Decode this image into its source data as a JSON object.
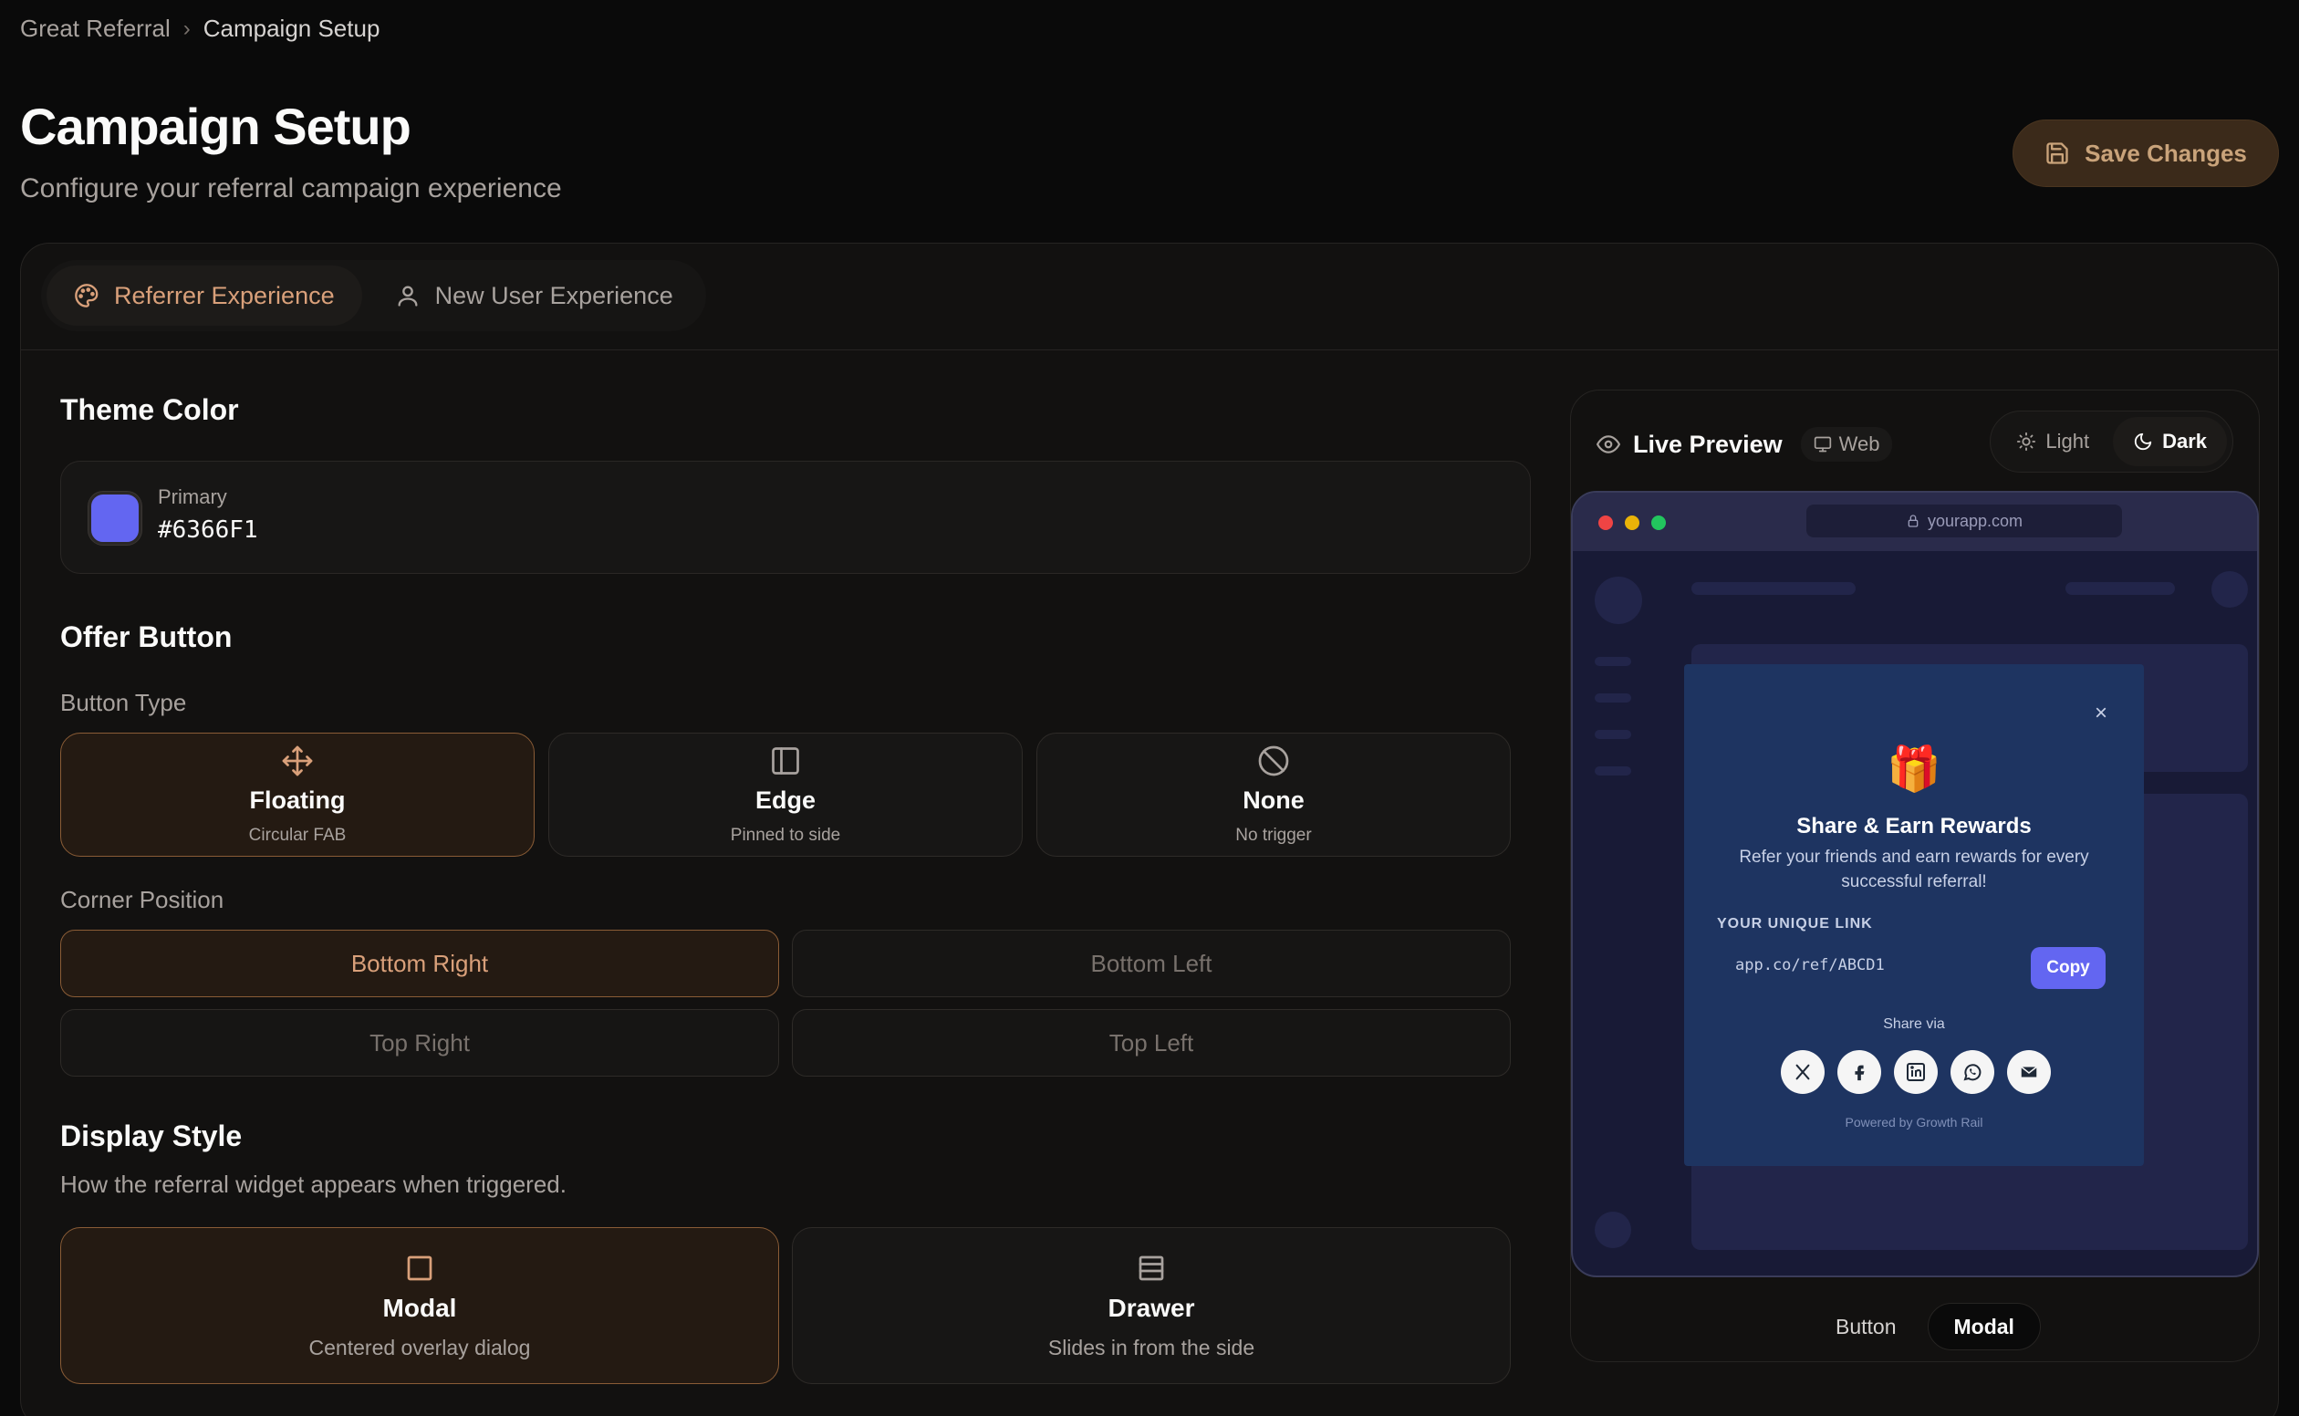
{
  "breadcrumb": {
    "root": "Great Referral",
    "separator": "›",
    "current": "Campaign Setup"
  },
  "header": {
    "title": "Campaign Setup",
    "subtitle": "Configure your referral campaign experience",
    "save_label": "Save Changes"
  },
  "tabs": [
    {
      "label": "Referrer Experience",
      "icon": "palette-icon",
      "active": true
    },
    {
      "label": "New User Experience",
      "icon": "user-icon",
      "active": false
    }
  ],
  "theme": {
    "title": "Theme Color",
    "color_label": "Primary",
    "color_value": "#6366F1"
  },
  "offer_button": {
    "title": "Offer Button",
    "button_type_label": "Button Type",
    "types": [
      {
        "title": "Floating",
        "sub": "Circular FAB",
        "icon": "move-icon",
        "selected": true
      },
      {
        "title": "Edge",
        "sub": "Pinned to side",
        "icon": "panel-left-icon",
        "selected": false
      },
      {
        "title": "None",
        "sub": "No trigger",
        "icon": "ban-icon",
        "selected": false
      }
    ],
    "corner_label": "Corner Position",
    "corners": [
      {
        "label": "Bottom Right",
        "selected": true
      },
      {
        "label": "Bottom Left",
        "selected": false
      },
      {
        "label": "Top Right",
        "selected": false
      },
      {
        "label": "Top Left",
        "selected": false
      }
    ]
  },
  "display_style": {
    "title": "Display Style",
    "description": "How the referral widget appears when triggered.",
    "options": [
      {
        "title": "Modal",
        "sub": "Centered overlay dialog",
        "icon": "square-icon",
        "selected": true
      },
      {
        "title": "Drawer",
        "sub": "Slides in from the side",
        "icon": "drawer-icon",
        "selected": false
      }
    ]
  },
  "preview": {
    "title": "Live Preview",
    "platform": "Web",
    "theme_light": "Light",
    "theme_dark": "Dark",
    "active_theme": "Dark",
    "url": "yourapp.com",
    "modal": {
      "close": "×",
      "gift": "🎁",
      "title": "Share & Earn Rewards",
      "description": "Refer your friends and earn rewards for every successful referral!",
      "link_label": "YOUR UNIQUE LINK",
      "link": "app.co/ref/ABCD1",
      "copy_label": "Copy",
      "share_via": "Share via",
      "share_icons": [
        "x-icon",
        "facebook-icon",
        "linkedin-icon",
        "whatsapp-icon",
        "mail-icon"
      ],
      "powered": "Powered by Growth Rail"
    },
    "switch": [
      {
        "label": "Button",
        "active": false
      },
      {
        "label": "Modal",
        "active": true
      }
    ]
  },
  "colors": {
    "accent": "#d9a07a",
    "primary": "#6366F1",
    "background": "#0a0a0a"
  }
}
